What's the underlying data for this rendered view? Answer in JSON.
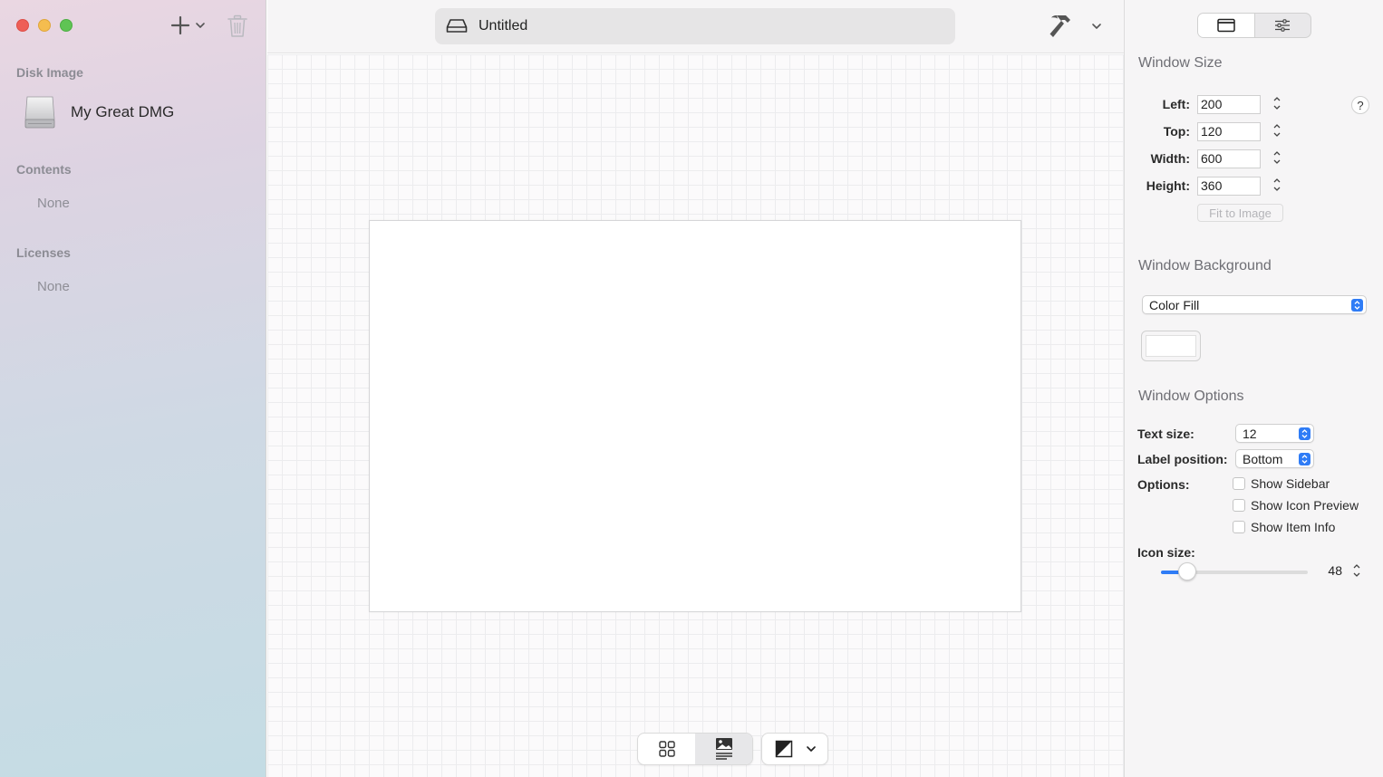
{
  "sidebar": {
    "sections": {
      "disk_image": "Disk Image",
      "contents": "Contents",
      "licenses": "Licenses"
    },
    "disk_image_name": "My Great DMG",
    "contents_empty": "None",
    "licenses_empty": "None"
  },
  "toolbar": {
    "title": "Untitled"
  },
  "canvas": {
    "view_modes": [
      "icon-grid",
      "background-image"
    ],
    "active_view_mode": "background-image"
  },
  "inspector": {
    "tabs": [
      "window-tab",
      "settings-tab"
    ],
    "active_tab": "window-tab",
    "window_size": {
      "heading": "Window Size",
      "left_label": "Left:",
      "left_value": "200",
      "top_label": "Top:",
      "top_value": "120",
      "width_label": "Width:",
      "width_value": "600",
      "height_label": "Height:",
      "height_value": "360",
      "fit_button": "Fit to Image",
      "help": "?"
    },
    "window_background": {
      "heading": "Window Background",
      "mode": "Color Fill",
      "color": "#ffffff"
    },
    "window_options": {
      "heading": "Window Options",
      "text_size_label": "Text size:",
      "text_size_value": "12",
      "label_position_label": "Label position:",
      "label_position_value": "Bottom",
      "options_label": "Options:",
      "show_sidebar": "Show Sidebar",
      "show_icon_preview": "Show Icon Preview",
      "show_item_info": "Show Item Info",
      "icon_size_label": "Icon size:",
      "icon_size_value": "48",
      "icon_size_slider_fraction": 0.18
    }
  },
  "colors": {
    "accent": "#2f7cf6",
    "close": "#ee5f57",
    "minimize": "#f5bd4f",
    "maximize": "#5fc454"
  }
}
